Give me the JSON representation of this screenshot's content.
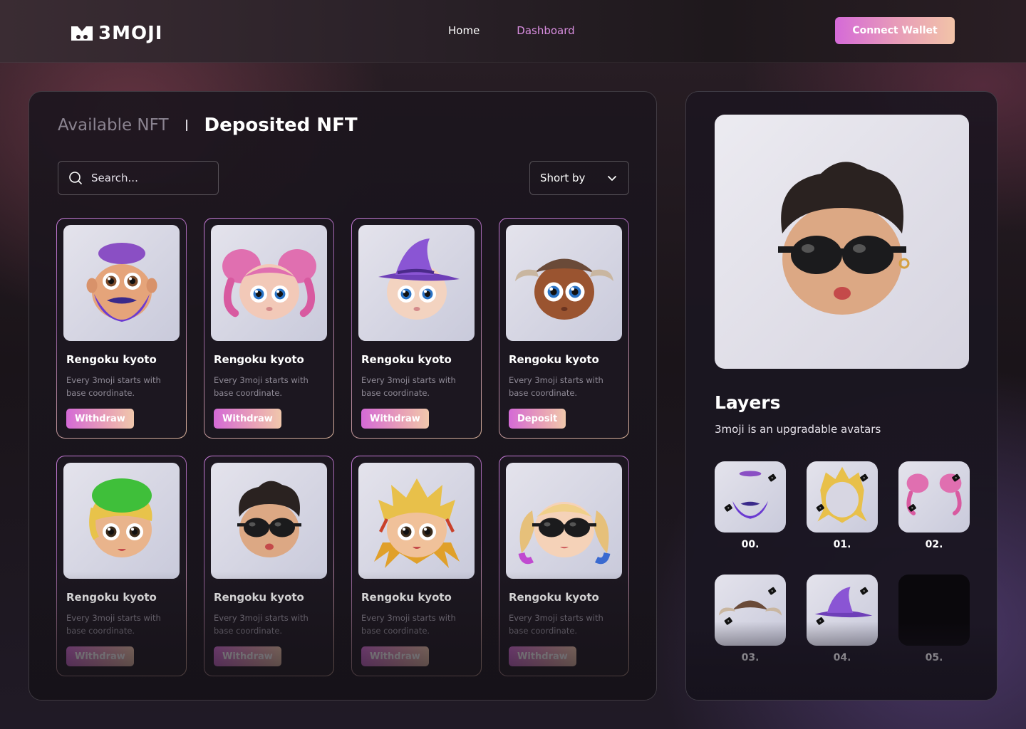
{
  "header": {
    "logo_text": "3MOJI",
    "nav": [
      {
        "label": "Home",
        "active": false
      },
      {
        "label": "Dashboard",
        "active": true
      }
    ],
    "connect_label": "Connect Wallet"
  },
  "main": {
    "tab_available": "Available NFT",
    "tab_deposited": "Deposited NFT",
    "search_placeholder": "Search...",
    "sort_label": "Short by",
    "cards": [
      {
        "title": "Rengoku kyoto",
        "desc": "Every 3moji starts with base coordinate.",
        "button": "Withdraw",
        "avatar": "bearded"
      },
      {
        "title": "Rengoku kyoto",
        "desc": "Every 3moji starts with base coordinate.",
        "button": "Withdraw",
        "avatar": "pink-pigtails"
      },
      {
        "title": "Rengoku kyoto",
        "desc": "Every 3moji starts with base coordinate.",
        "button": "Withdraw",
        "avatar": "witch-hat"
      },
      {
        "title": "Rengoku kyoto",
        "desc": "Every 3moji starts with base coordinate.",
        "button": "Deposit",
        "avatar": "horned"
      },
      {
        "title": "Rengoku kyoto",
        "desc": "Every 3moji starts with base coordinate.",
        "button": "Withdraw",
        "avatar": "green-cap"
      },
      {
        "title": "Rengoku kyoto",
        "desc": "Every 3moji starts with base coordinate.",
        "button": "Withdraw",
        "avatar": "sunglasses"
      },
      {
        "title": "Rengoku kyoto",
        "desc": "Every 3moji starts with base coordinate.",
        "button": "Withdraw",
        "avatar": "spiky-blonde"
      },
      {
        "title": "Rengoku kyoto",
        "desc": "Every 3moji starts with base coordinate.",
        "button": "Withdraw",
        "avatar": "blonde-pigtails"
      }
    ]
  },
  "side": {
    "layers_title": "Layers",
    "layers_subtitle": "3moji is an upgradable avatars",
    "layers": [
      {
        "label": "00.",
        "kind": "beard"
      },
      {
        "label": "01.",
        "kind": "spiky-hair"
      },
      {
        "label": "02.",
        "kind": "pink-hair"
      },
      {
        "label": "03.",
        "kind": "horns"
      },
      {
        "label": "04.",
        "kind": "witch-hat"
      },
      {
        "label": "05.",
        "kind": "empty"
      }
    ]
  },
  "colors": {
    "accent_pink": "#d56ad8",
    "accent_peach": "#f2c4a8",
    "nav_active": "#d98ee0"
  }
}
